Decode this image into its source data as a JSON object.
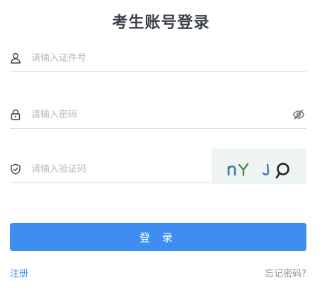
{
  "title": "考生账号登录",
  "form": {
    "id_placeholder": "请输入证件号",
    "password_placeholder": "请输入密码",
    "captcha_placeholder": "请输入验证码",
    "captcha_text": "nY ⌡ ϙ"
  },
  "actions": {
    "login_label": "登 录",
    "register_label": "注册",
    "forgot_label": "忘记密码?"
  },
  "colors": {
    "primary": "#3e8ef2",
    "title": "#3a3f4b",
    "divider": "#d6d8dc"
  },
  "icons": {
    "id_field": "user-icon",
    "password_field": "lock-icon",
    "password_toggle": "eye-off-icon",
    "captcha_field": "shield-icon"
  }
}
